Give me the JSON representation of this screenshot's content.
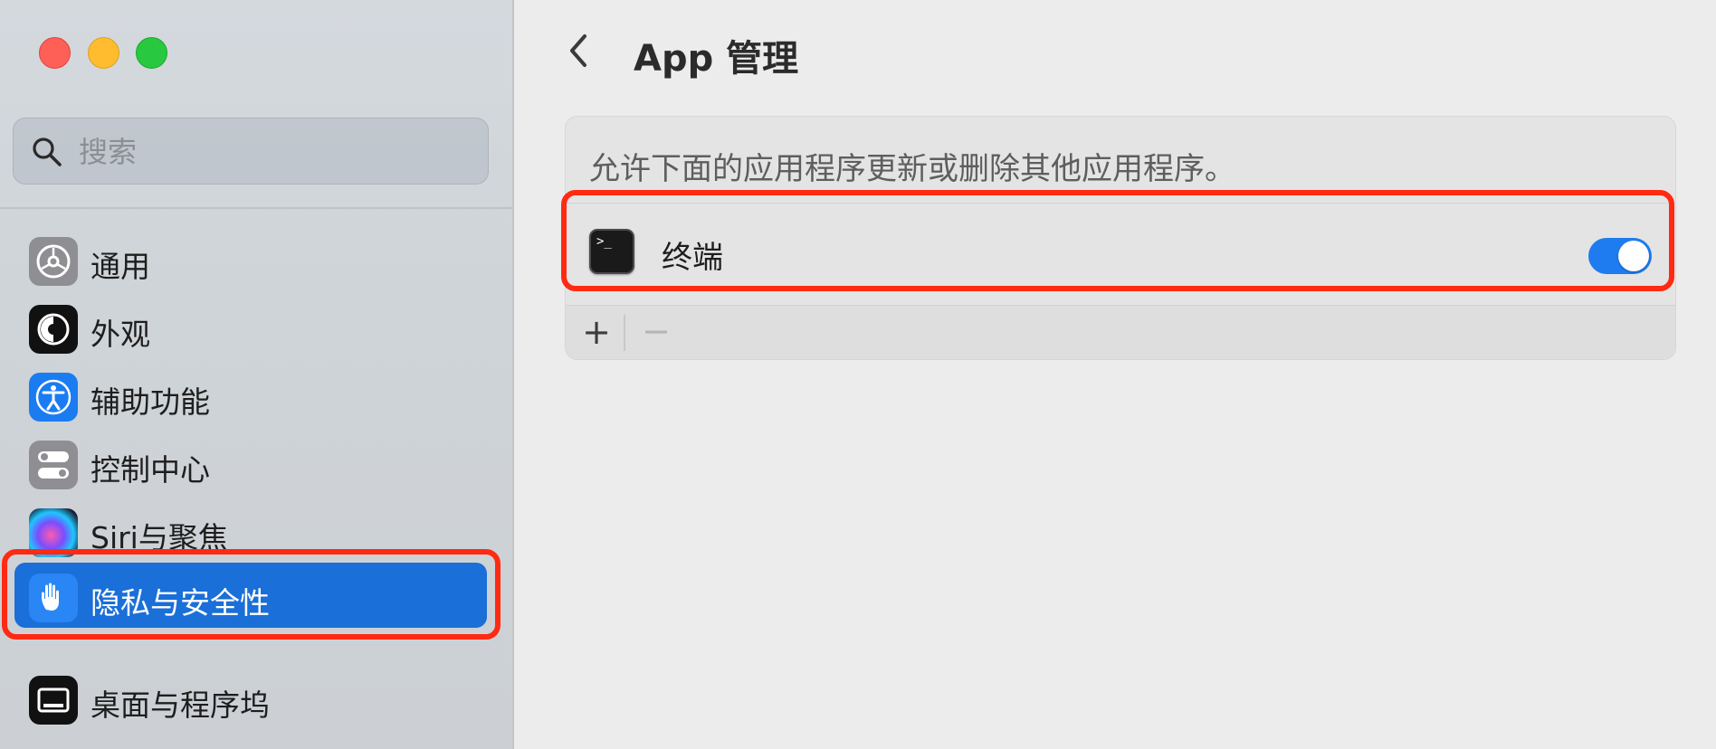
{
  "sidebar": {
    "search": {
      "placeholder": "搜索",
      "icon": "search-icon"
    },
    "items": [
      {
        "label": "通用",
        "icon": "gear-icon"
      },
      {
        "label": "外观",
        "icon": "appearance-icon"
      },
      {
        "label": "辅助功能",
        "icon": "accessibility-icon"
      },
      {
        "label": "控制中心",
        "icon": "toggles-icon"
      },
      {
        "label": "Siri与聚焦",
        "icon": "siri-icon"
      },
      {
        "label": "隐私与安全性",
        "icon": "hand-icon",
        "selected": true
      },
      {
        "label": "桌面与程序坞",
        "icon": "dock-icon"
      }
    ]
  },
  "main": {
    "title": "App 管理",
    "description": "允许下面的应用程序更新或删除其他应用程序。",
    "apps": [
      {
        "name": "终端",
        "icon": "terminal-icon",
        "enabled": true
      }
    ],
    "add_label": "+",
    "remove_label": "−"
  },
  "colors": {
    "accent": "#1a6fd8",
    "toggle_on": "#1e7cf0",
    "highlight": "#ff2a12",
    "traffic_close": "#fe5f57",
    "traffic_minimize": "#febc2e",
    "traffic_maximize": "#28c840"
  }
}
